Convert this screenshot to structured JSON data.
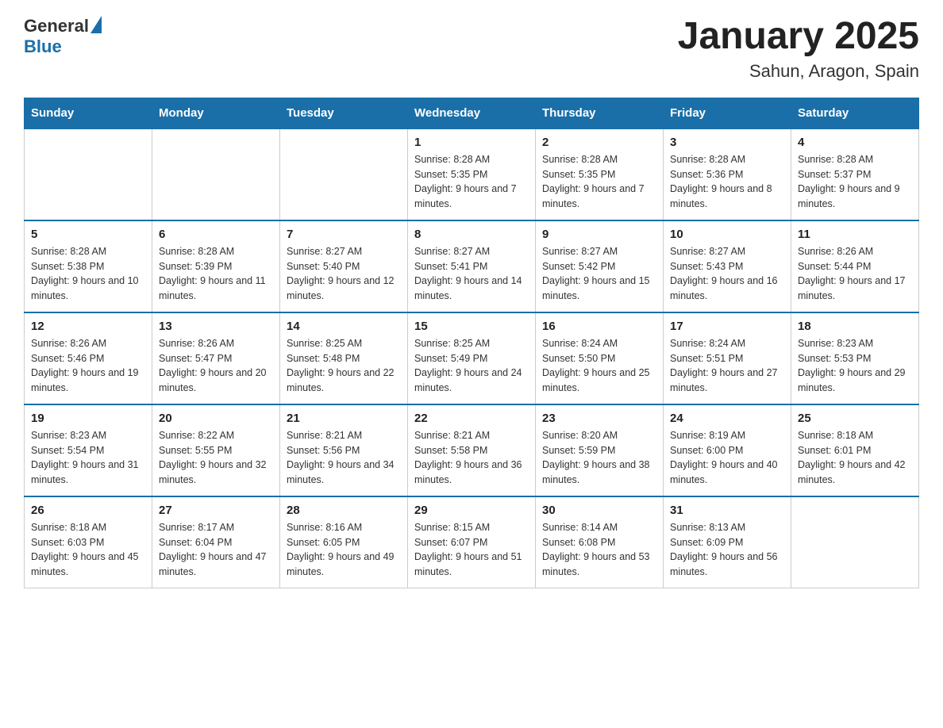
{
  "logo": {
    "general": "General",
    "blue": "Blue"
  },
  "title": "January 2025",
  "subtitle": "Sahun, Aragon, Spain",
  "weekdays": [
    "Sunday",
    "Monday",
    "Tuesday",
    "Wednesday",
    "Thursday",
    "Friday",
    "Saturday"
  ],
  "weeks": [
    [
      {
        "day": "",
        "info": ""
      },
      {
        "day": "",
        "info": ""
      },
      {
        "day": "",
        "info": ""
      },
      {
        "day": "1",
        "info": "Sunrise: 8:28 AM\nSunset: 5:35 PM\nDaylight: 9 hours and 7 minutes."
      },
      {
        "day": "2",
        "info": "Sunrise: 8:28 AM\nSunset: 5:35 PM\nDaylight: 9 hours and 7 minutes."
      },
      {
        "day": "3",
        "info": "Sunrise: 8:28 AM\nSunset: 5:36 PM\nDaylight: 9 hours and 8 minutes."
      },
      {
        "day": "4",
        "info": "Sunrise: 8:28 AM\nSunset: 5:37 PM\nDaylight: 9 hours and 9 minutes."
      }
    ],
    [
      {
        "day": "5",
        "info": "Sunrise: 8:28 AM\nSunset: 5:38 PM\nDaylight: 9 hours and 10 minutes."
      },
      {
        "day": "6",
        "info": "Sunrise: 8:28 AM\nSunset: 5:39 PM\nDaylight: 9 hours and 11 minutes."
      },
      {
        "day": "7",
        "info": "Sunrise: 8:27 AM\nSunset: 5:40 PM\nDaylight: 9 hours and 12 minutes."
      },
      {
        "day": "8",
        "info": "Sunrise: 8:27 AM\nSunset: 5:41 PM\nDaylight: 9 hours and 14 minutes."
      },
      {
        "day": "9",
        "info": "Sunrise: 8:27 AM\nSunset: 5:42 PM\nDaylight: 9 hours and 15 minutes."
      },
      {
        "day": "10",
        "info": "Sunrise: 8:27 AM\nSunset: 5:43 PM\nDaylight: 9 hours and 16 minutes."
      },
      {
        "day": "11",
        "info": "Sunrise: 8:26 AM\nSunset: 5:44 PM\nDaylight: 9 hours and 17 minutes."
      }
    ],
    [
      {
        "day": "12",
        "info": "Sunrise: 8:26 AM\nSunset: 5:46 PM\nDaylight: 9 hours and 19 minutes."
      },
      {
        "day": "13",
        "info": "Sunrise: 8:26 AM\nSunset: 5:47 PM\nDaylight: 9 hours and 20 minutes."
      },
      {
        "day": "14",
        "info": "Sunrise: 8:25 AM\nSunset: 5:48 PM\nDaylight: 9 hours and 22 minutes."
      },
      {
        "day": "15",
        "info": "Sunrise: 8:25 AM\nSunset: 5:49 PM\nDaylight: 9 hours and 24 minutes."
      },
      {
        "day": "16",
        "info": "Sunrise: 8:24 AM\nSunset: 5:50 PM\nDaylight: 9 hours and 25 minutes."
      },
      {
        "day": "17",
        "info": "Sunrise: 8:24 AM\nSunset: 5:51 PM\nDaylight: 9 hours and 27 minutes."
      },
      {
        "day": "18",
        "info": "Sunrise: 8:23 AM\nSunset: 5:53 PM\nDaylight: 9 hours and 29 minutes."
      }
    ],
    [
      {
        "day": "19",
        "info": "Sunrise: 8:23 AM\nSunset: 5:54 PM\nDaylight: 9 hours and 31 minutes."
      },
      {
        "day": "20",
        "info": "Sunrise: 8:22 AM\nSunset: 5:55 PM\nDaylight: 9 hours and 32 minutes."
      },
      {
        "day": "21",
        "info": "Sunrise: 8:21 AM\nSunset: 5:56 PM\nDaylight: 9 hours and 34 minutes."
      },
      {
        "day": "22",
        "info": "Sunrise: 8:21 AM\nSunset: 5:58 PM\nDaylight: 9 hours and 36 minutes."
      },
      {
        "day": "23",
        "info": "Sunrise: 8:20 AM\nSunset: 5:59 PM\nDaylight: 9 hours and 38 minutes."
      },
      {
        "day": "24",
        "info": "Sunrise: 8:19 AM\nSunset: 6:00 PM\nDaylight: 9 hours and 40 minutes."
      },
      {
        "day": "25",
        "info": "Sunrise: 8:18 AM\nSunset: 6:01 PM\nDaylight: 9 hours and 42 minutes."
      }
    ],
    [
      {
        "day": "26",
        "info": "Sunrise: 8:18 AM\nSunset: 6:03 PM\nDaylight: 9 hours and 45 minutes."
      },
      {
        "day": "27",
        "info": "Sunrise: 8:17 AM\nSunset: 6:04 PM\nDaylight: 9 hours and 47 minutes."
      },
      {
        "day": "28",
        "info": "Sunrise: 8:16 AM\nSunset: 6:05 PM\nDaylight: 9 hours and 49 minutes."
      },
      {
        "day": "29",
        "info": "Sunrise: 8:15 AM\nSunset: 6:07 PM\nDaylight: 9 hours and 51 minutes."
      },
      {
        "day": "30",
        "info": "Sunrise: 8:14 AM\nSunset: 6:08 PM\nDaylight: 9 hours and 53 minutes."
      },
      {
        "day": "31",
        "info": "Sunrise: 8:13 AM\nSunset: 6:09 PM\nDaylight: 9 hours and 56 minutes."
      },
      {
        "day": "",
        "info": ""
      }
    ]
  ]
}
